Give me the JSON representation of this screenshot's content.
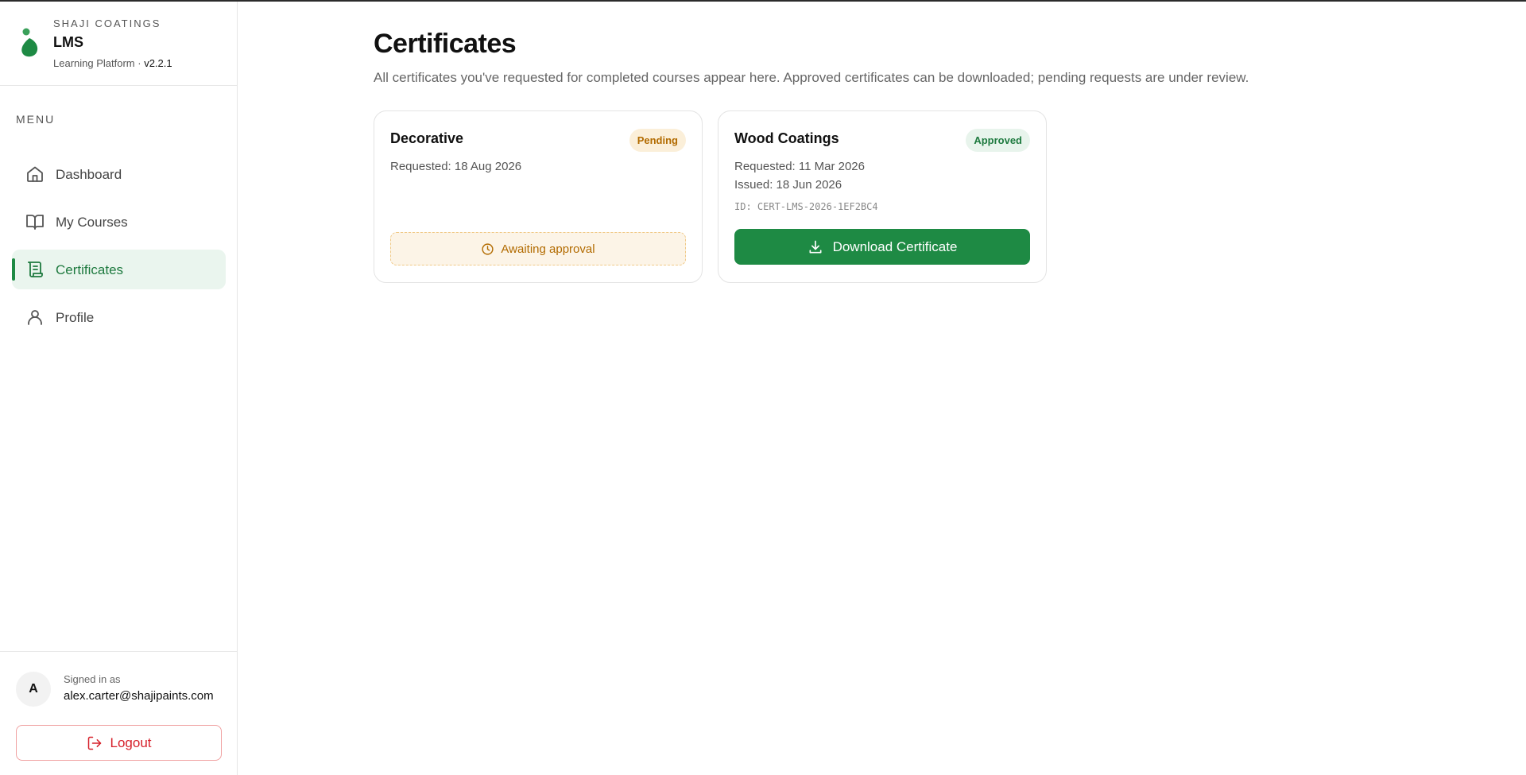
{
  "brand": {
    "company": "SHAJI COATINGS",
    "name": "LMS",
    "subtitle": "Learning Platform ·",
    "version": "v2.2.1",
    "logo_icon": "leaf-drop-icon",
    "accent_color": "#1e8a44"
  },
  "menu": {
    "label": "MENU",
    "items": [
      {
        "label": "Dashboard",
        "icon": "home-icon",
        "active": false
      },
      {
        "label": "My Courses",
        "icon": "book-open-icon",
        "active": false
      },
      {
        "label": "Certificates",
        "icon": "scroll-icon",
        "active": true
      },
      {
        "label": "Profile",
        "icon": "user-icon",
        "active": false
      }
    ]
  },
  "account": {
    "avatar_initial": "A",
    "signed_in_label": "Signed in as",
    "email": "alex.carter@shajipaints.com",
    "logout_label": "Logout",
    "logout_color": "#d6202a"
  },
  "page": {
    "title": "Certificates",
    "description": "All certificates you've requested for completed courses appear here. Approved certificates can be downloaded; pending requests are under review."
  },
  "certificates": [
    {
      "course": "Decorative",
      "status": "Pending",
      "status_color": "#b26b00",
      "requested": "Requested: 18 Aug 2026",
      "action_label": "Awaiting approval",
      "action_icon": "clock-icon"
    },
    {
      "course": "Wood Coatings",
      "status": "Approved",
      "status_color": "#1e7a3f",
      "requested": "Requested: 11 Mar 2026",
      "issued": "Issued: 18 Jun 2026",
      "cert_id": "ID: CERT-LMS-2026-1EF2BC4",
      "action_label": "Download Certificate",
      "action_icon": "download-icon"
    }
  ]
}
